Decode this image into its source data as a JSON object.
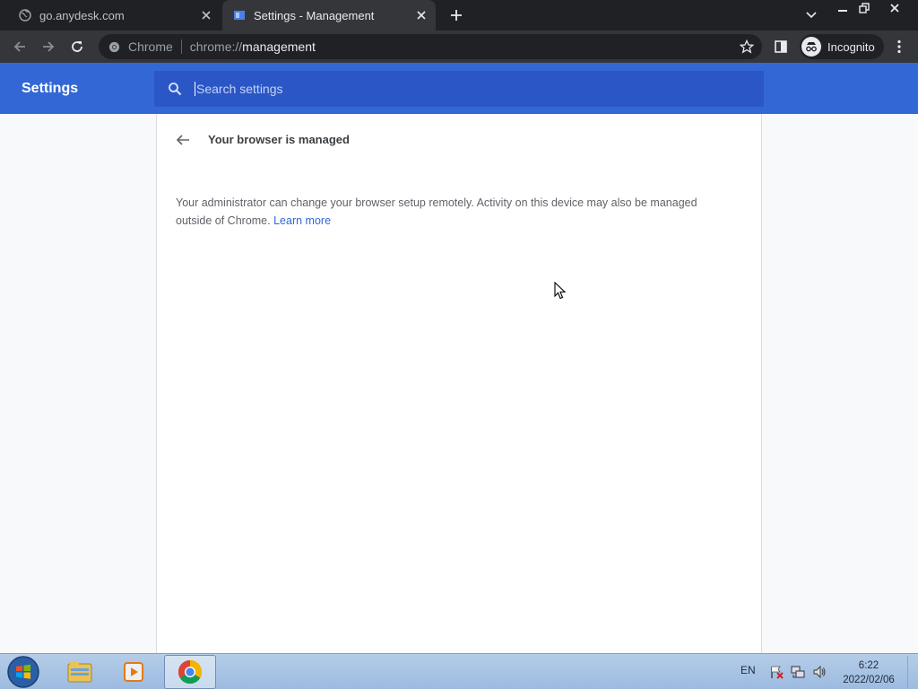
{
  "browser": {
    "tabs": [
      {
        "title": "go.anydesk.com",
        "icon": "globe-icon",
        "active": false
      },
      {
        "title": "Settings - Management",
        "icon": "settings-page-icon",
        "active": true
      }
    ],
    "omnibox": {
      "chip_label": "Chrome",
      "url_scheme": "chrome://",
      "url_host": "management"
    },
    "profile_label": "Incognito"
  },
  "settings": {
    "header_title": "Settings",
    "search_placeholder": "Search settings",
    "page_title": "Your browser is managed",
    "description": "Your administrator can change your browser setup remotely. Activity on this device may also be managed outside of Chrome.",
    "learn_more": "Learn more"
  },
  "taskbar": {
    "language": "EN",
    "time": "6:22",
    "date": "2022/02/06",
    "apps": [
      "explorer-icon",
      "media-player-icon",
      "chrome-icon"
    ]
  },
  "colors": {
    "header_blue": "#3367d6",
    "link_blue": "#3367d6",
    "dark_chrome": "#202124"
  }
}
